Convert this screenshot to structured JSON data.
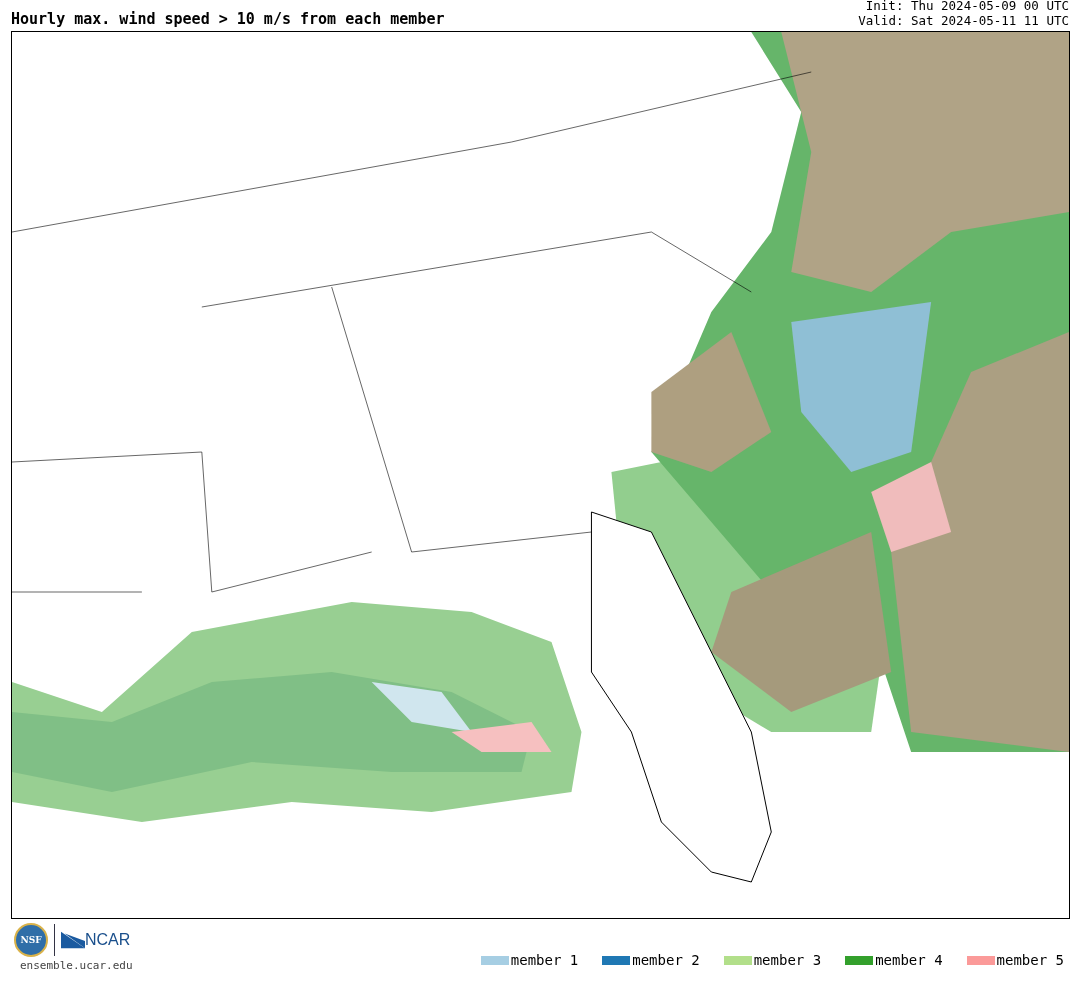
{
  "title": "Hourly max. wind speed > 10 m/s from each member",
  "init": "Init: Thu 2024-05-09 00 UTC",
  "valid": "Valid: Sat 2024-05-11 11 UTC",
  "logos": {
    "nsf": "NSF",
    "ncar": "NCAR",
    "site": "ensemble.ucar.edu"
  },
  "legend": [
    {
      "label": "member 1",
      "color": "#a6cee3"
    },
    {
      "label": "member 2",
      "color": "#1f78b4"
    },
    {
      "label": "member 3",
      "color": "#b2df8a"
    },
    {
      "label": "member 4",
      "color": "#33a02c"
    },
    {
      "label": "member 5",
      "color": "#fb9a99"
    }
  ]
}
